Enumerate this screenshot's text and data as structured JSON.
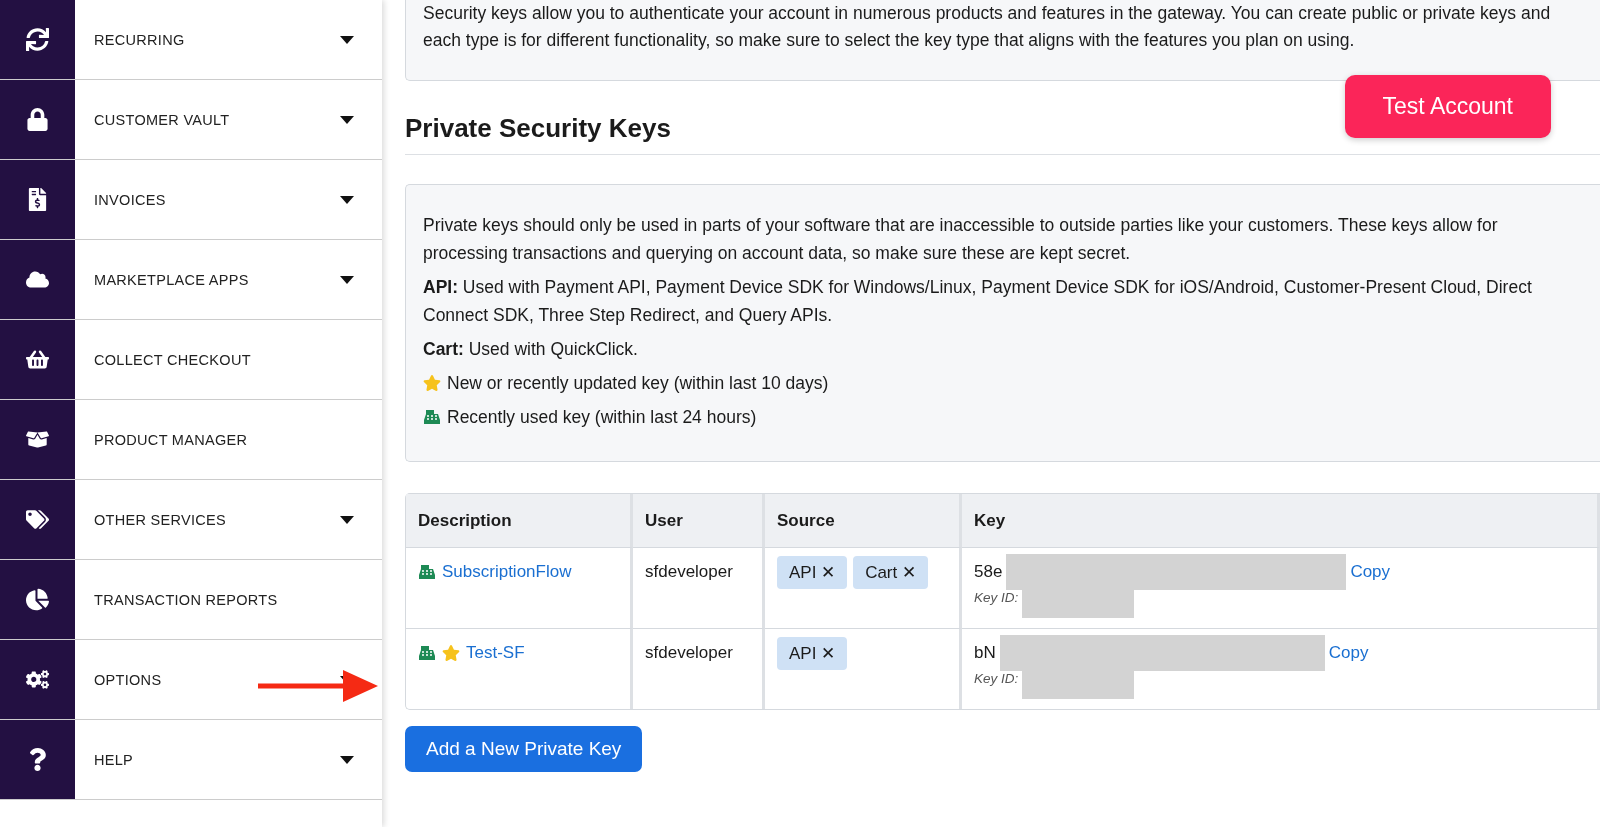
{
  "sidebar": {
    "items": [
      {
        "label": "RECURRING",
        "expandable": true
      },
      {
        "label": "CUSTOMER VAULT",
        "expandable": true
      },
      {
        "label": "INVOICES",
        "expandable": true
      },
      {
        "label": "MARKETPLACE APPS",
        "expandable": true
      },
      {
        "label": "COLLECT CHECKOUT",
        "expandable": false
      },
      {
        "label": "PRODUCT MANAGER",
        "expandable": false
      },
      {
        "label": "OTHER SERVICES",
        "expandable": true
      },
      {
        "label": "TRANSACTION REPORTS",
        "expandable": false
      },
      {
        "label": "OPTIONS",
        "expandable": true
      },
      {
        "label": "HELP",
        "expandable": true
      }
    ]
  },
  "intro": "Security keys allow you to authenticate your account in numerous products and features in the gateway. You can create public or private keys and each type is for different functionality, so make sure to select the key type that aligns with the features you plan on using.",
  "test_account_button": "Test Account",
  "heading": "Private Security Keys",
  "info": {
    "paragraphs": [
      "Private keys should only be used in parts of your software that are inaccessible to outside parties like your customers. These keys allow for processing transactions and querying on account data, so make sure these are kept secret.",
      "**API:** Used with Payment API, Payment Device SDK for Windows/Linux, Payment Device SDK for iOS/Android, Customer-Present Cloud, Direct Connect SDK, Three Step Redirect, and Query APIs.",
      "**Cart:** Used with QuickClick."
    ],
    "legend": [
      {
        "kind": "new",
        "text": "New or recently updated key (within last 10 days)"
      },
      {
        "kind": "recent",
        "text": "Recently used key (within last 24 hours)"
      }
    ]
  },
  "table": {
    "columns": [
      "Description",
      "User",
      "Source",
      "Key"
    ],
    "rows": [
      {
        "recent": true,
        "new": false,
        "description": "SubscriptionFlow",
        "user": "sfdeveloper",
        "sources": [
          "API ✕",
          "Cart ✕"
        ],
        "key": "58e",
        "copy": "Copy",
        "key_id_label": "Key ID:"
      },
      {
        "recent": true,
        "new": true,
        "description": "Test-SF",
        "user": "sfdeveloper",
        "sources": [
          "API ✕"
        ],
        "key": "bN",
        "copy": "Copy",
        "key_id_label": "Key ID:"
      }
    ]
  },
  "add_button": "Add a New Private Key"
}
